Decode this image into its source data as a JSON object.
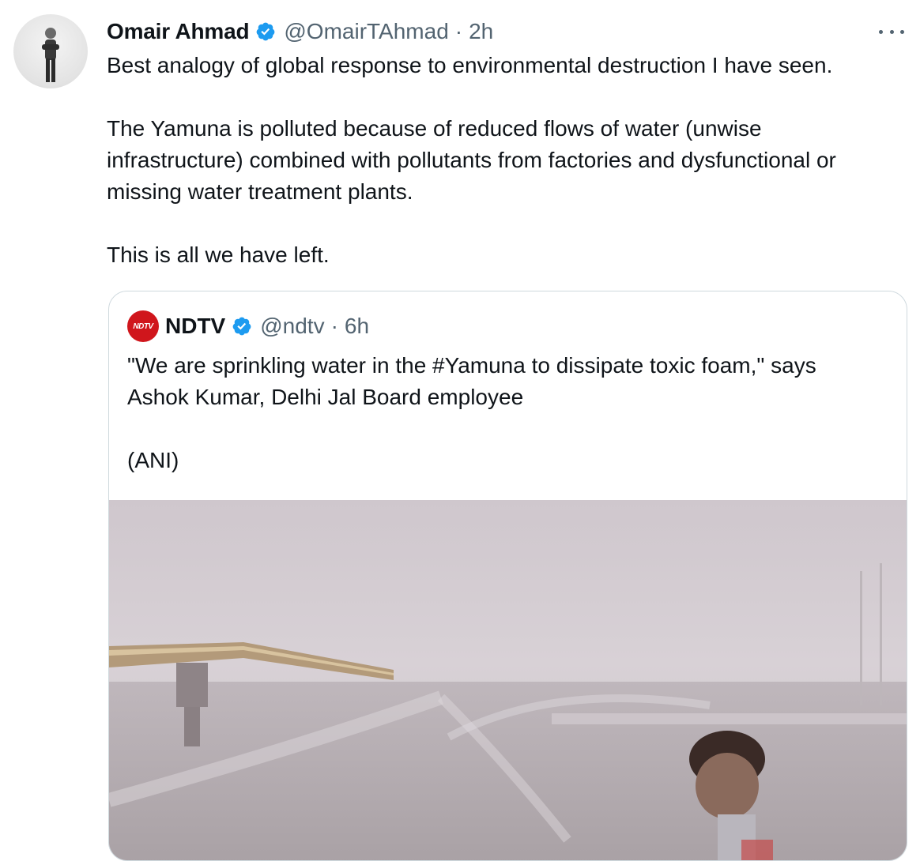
{
  "author": {
    "name": "Omair Ahmad",
    "handle": "@OmairTAhmad",
    "separator": "·",
    "time": "2h"
  },
  "icons": {
    "verified": "verified-badge-icon",
    "more": "more-options-icon",
    "avatar": "profile-photo",
    "ndtv_logo": "ndtv-logo"
  },
  "colors": {
    "verified": "#1d9bf0",
    "secondary_text": "#536471",
    "ndtv_red": "#d0161c",
    "border": "#cfd9de"
  },
  "tweet": {
    "paragraph1": "Best analogy of global response to environmental destruction I have seen.",
    "paragraph2_line1": "The Yamuna is polluted because of reduced flows of water (unwise",
    "paragraph2_line2": "infrastructure) combined with pollutants from factories and dysfunctional or",
    "paragraph2_line3": "missing water treatment plants.",
    "paragraph3": "This is all we have left."
  },
  "quoted": {
    "logo_text": "NDTV",
    "name": "NDTV",
    "handle": "@ndtv",
    "separator": "·",
    "time": "6h",
    "line1": "\"We are sprinkling water in the #Yamuna to dissipate toxic foam,\" says",
    "line2": "Ashok Kumar, Delhi Jal Board employee",
    "line3": "(ANI)"
  }
}
